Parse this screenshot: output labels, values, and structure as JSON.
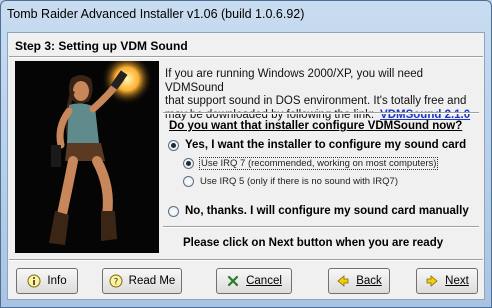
{
  "window": {
    "title": "Tomb Raider Advanced Installer v1.06 (build 1.0.6.92)"
  },
  "step": {
    "title": "Step 3: Setting up VDM Sound"
  },
  "description": {
    "line1": "If you are running Windows 2000/XP, you will need VDMSound",
    "line2": "that support sound in DOS environment. It's totally free and",
    "line3": "may be downloaded by following the link:",
    "link_text": "VDMSound 2.1.0"
  },
  "question": "Do you want that installer configure VDMSound now?",
  "options": {
    "yes": {
      "label": "Yes, I want the installer to configure my sound card",
      "selected": true,
      "sub": [
        {
          "label": "Use IRQ 7 (recommended, working on most computers)",
          "selected": true
        },
        {
          "label": "Use IRQ 5 (only if there is no sound with IRQ7)",
          "selected": false
        }
      ]
    },
    "no": {
      "label": "No, thanks. I will configure my sound card manually",
      "selected": false
    }
  },
  "hint": "Please click on Next button when you are ready",
  "buttons": {
    "info": {
      "label": "Info",
      "icon": "info-icon"
    },
    "readme": {
      "label": "Read Me",
      "icon": "question-icon"
    },
    "cancel": {
      "label": "Cancel",
      "icon": "cancel-icon"
    },
    "back": {
      "label": "Back",
      "icon": "back-arrow-icon"
    },
    "next": {
      "label": "Next",
      "icon": "next-arrow-icon"
    }
  },
  "colors": {
    "link": "#1a35c8",
    "flame": "#ff8a1a"
  }
}
